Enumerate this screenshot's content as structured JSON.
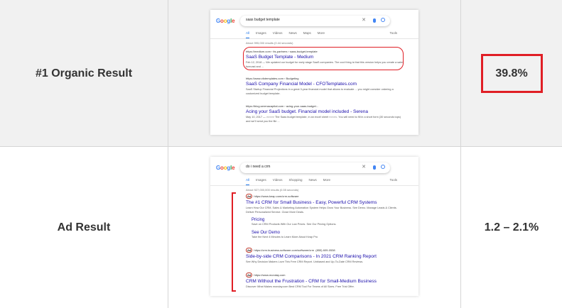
{
  "rows": [
    {
      "label": "#1 Organic Result",
      "value": "39.8%",
      "serp": {
        "query": "saas budget template",
        "tabs": [
          "All",
          "Images",
          "Videos",
          "News",
          "Maps",
          "More"
        ],
        "tools": "Tools",
        "stats": "About 995,000 results (0.44 seconds)",
        "results": [
          {
            "url": "https://medium.com › its-partners › saas-budget-template",
            "title": "SaaS Budget Template - Medium",
            "snippet": "Feb 12, 2018 — We updated our budget for early stage SaaS companies. The cool thing is that this version helps you create a sales forecast and ..."
          },
          {
            "url": "https://www.cfotemplates.com › Budgeting",
            "title": "SaaS Company Financial Model - CFOTemplates.com",
            "snippet": "SaaS Startup Financial Projections in a great 3-year financial model that allows to evaluate ... you might consider ordering a customized budget template."
          },
          {
            "url": "https://blog.serenacapital.com › acing-your-saas-budget...",
            "title": "Acing your SaaS budget. Financial model included - Serena",
            "snippet": "May 10, 2017 — >>>>> The Saas budget template, in an excel sheet <<<<<. You will need to fill in a short form (30 seconds tops) and we'll send you the file ..."
          }
        ]
      }
    },
    {
      "label": "Ad Result",
      "value": "1.2 – 2.1%",
      "serp": {
        "query": "do i need a crm",
        "tabs": [
          "All",
          "Images",
          "Videos",
          "Shopping",
          "News",
          "More"
        ],
        "tools": "Tools",
        "stats": "About 927,000,000 results (0.55 seconds)",
        "ad_tag": "Ad",
        "results": [
          {
            "url": "https://www.keap.com/crm-software",
            "title": "The #1 CRM for Small Business - Easy, Powerful CRM Systems",
            "snippet": "Learn How Our CRM, Sales & Marketing Automation System Helps Grow Your Business. See Demo. Manage Leads & Clients. Deliver Personalized Service. Close More Deals."
          },
          {
            "url": "https://crm.business-software.com/software/crm",
            "title": "Side-by-side CRM Comparisons - In 2021 CRM Ranking Report",
            "snippet": "See Why Decision Makers Love This Free CRM Report. Unbiased and Up-To-Date CRM Reviews."
          },
          {
            "url": "https://www.monday.com",
            "title": "CRM Without the Frustration - CRM for Small-Medium Business",
            "snippet": "Discover What Makes monday.com Best CRM Tool For Teams of All Sizes. Free Trial Offer."
          }
        ],
        "sitelinks": [
          {
            "title": "Pricing",
            "snippet": "Save on CRM Products With Our Low Prices. See Our Pricing Options."
          },
          {
            "title": "See Our Demo",
            "snippet": "Take the Next 4 Minutes to Learn More About Keap Pro"
          }
        ],
        "phone": "(855) 609-0538"
      }
    }
  ],
  "colors": {
    "highlight": "#e01e25",
    "link": "#1a0dab",
    "row_alt_bg": "#f1f1f1"
  }
}
